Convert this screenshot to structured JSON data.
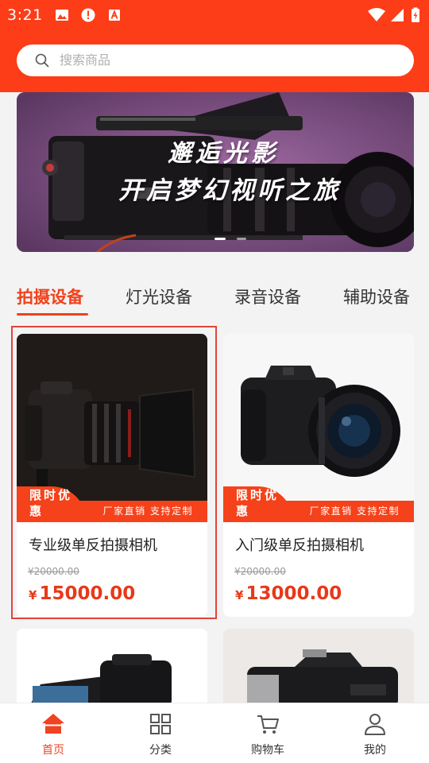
{
  "status_bar": {
    "time": "3:21"
  },
  "search": {
    "placeholder": "搜索商品"
  },
  "banner": {
    "line1": "邂逅光影",
    "line2": "开启梦幻视听之旅",
    "dots": 2,
    "active_dot": 0
  },
  "tabs": [
    {
      "label": "拍摄设备",
      "active": true
    },
    {
      "label": "灯光设备",
      "active": false
    },
    {
      "label": "录音设备",
      "active": false
    },
    {
      "label": "辅助设备",
      "active": false
    }
  ],
  "products": [
    {
      "name": "专业级单反拍摄相机",
      "promo_tag": "限时优惠",
      "promo_text": "厂家直销 支持定制",
      "original_price": "¥20000.00",
      "currency": "¥",
      "price": "15000.00",
      "selected": true
    },
    {
      "name": "入门级单反拍摄相机",
      "promo_tag": "限时优惠",
      "promo_text": "厂家直销 支持定制",
      "original_price": "¥20000.00",
      "currency": "¥",
      "price": "13000.00",
      "selected": false
    },
    {
      "name": "",
      "image": "camcorder"
    },
    {
      "name": "",
      "image": "bridge-camera"
    }
  ],
  "bottom_nav": [
    {
      "label": "首页",
      "icon": "home-icon",
      "active": true
    },
    {
      "label": "分类",
      "icon": "grid-icon",
      "active": false
    },
    {
      "label": "购物车",
      "icon": "cart-icon",
      "active": false
    },
    {
      "label": "我的",
      "icon": "user-icon",
      "active": false
    }
  ],
  "colors": {
    "brand": "#fc3d18",
    "price": "#e8391a",
    "tab_active": "#f0421c"
  }
}
